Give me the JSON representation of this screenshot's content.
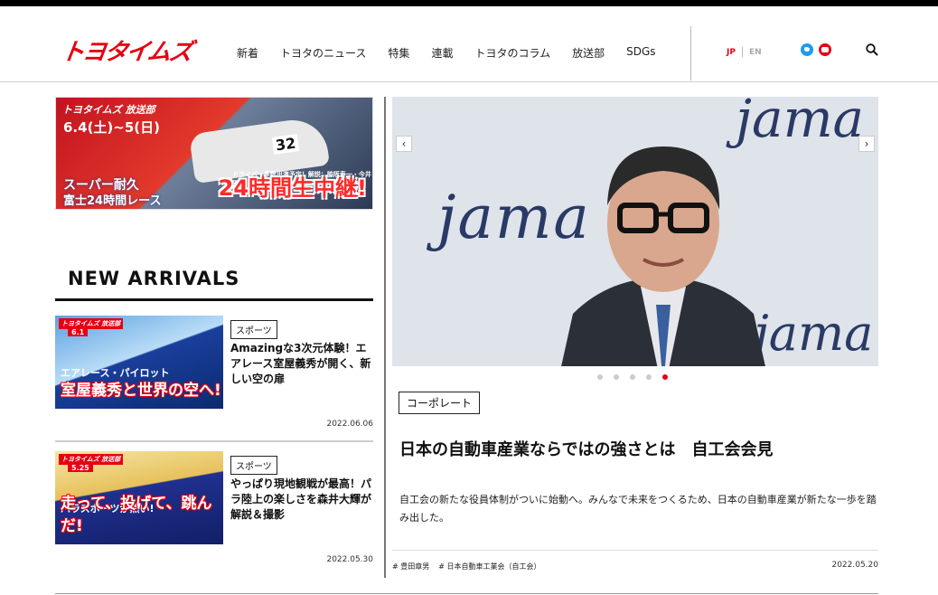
{
  "header": {
    "logo": "トヨタイムズ",
    "nav": [
      "新着",
      "トヨタのニュース",
      "特集",
      "連載",
      "トヨタのコラム",
      "放送部",
      "SDGs"
    ],
    "lang_jp": "JP",
    "lang_en": "EN"
  },
  "banner": {
    "brand": "トヨタイムズ 放送部",
    "date": "6.4(土)~5(日)",
    "car_number": "32",
    "drivers": "ドライバー多数出演予定！解説：脇阪寿一・今井優香",
    "sub1": "スーパー耐久",
    "sub2": "富士24時間レース",
    "main": "24時間生中継!"
  },
  "new_arrivals": {
    "title": "NEW ARRIVALS",
    "cards": [
      {
        "thumb_label": "トヨタイムズ 放送部",
        "thumb_date": "6.1",
        "thumb_mid": "エアレース・パイロット",
        "thumb_big": "室屋義秀と世界の空へ!",
        "tag": "スポーツ",
        "title": "Amazingな3次元体験！エアレース室屋義秀が開く、新しい空の扉",
        "date": "2022.06.06"
      },
      {
        "thumb_label": "トヨタイムズ 放送部",
        "thumb_date": "5.25",
        "thumb_mid": "パラスポーツが熱い!",
        "thumb_big": "走って、投げて、跳んだ!",
        "tag": "スポーツ",
        "title": "やっぱり現地観戦が最高！パラ陸上の楽しさを森井大輝が解説＆撮影",
        "date": "2022.05.30"
      }
    ]
  },
  "hero": {
    "bg_text": "jama",
    "tag": "コーポレート",
    "title": "日本の自動車産業ならではの強さとは　自工会会見",
    "description": "自工会の新たな役員体制がついに始動へ。みんなで未来をつくるため、日本の自動車産業が新たな一歩を踏み出した。",
    "keywords": [
      "# 豊田章男",
      "# 日本自動車工業会（自工会）"
    ],
    "date": "2022.05.20",
    "slides_total": 5,
    "slide_active": 5
  },
  "colors": {
    "brand_red": "#e60012",
    "text": "#111111",
    "twitter": "#1d9bf0"
  },
  "icons": {
    "social": [
      "twitter-icon",
      "youtube-icon"
    ],
    "search": "search-icon",
    "prev": "chevron-left-icon",
    "next": "chevron-right-icon"
  }
}
